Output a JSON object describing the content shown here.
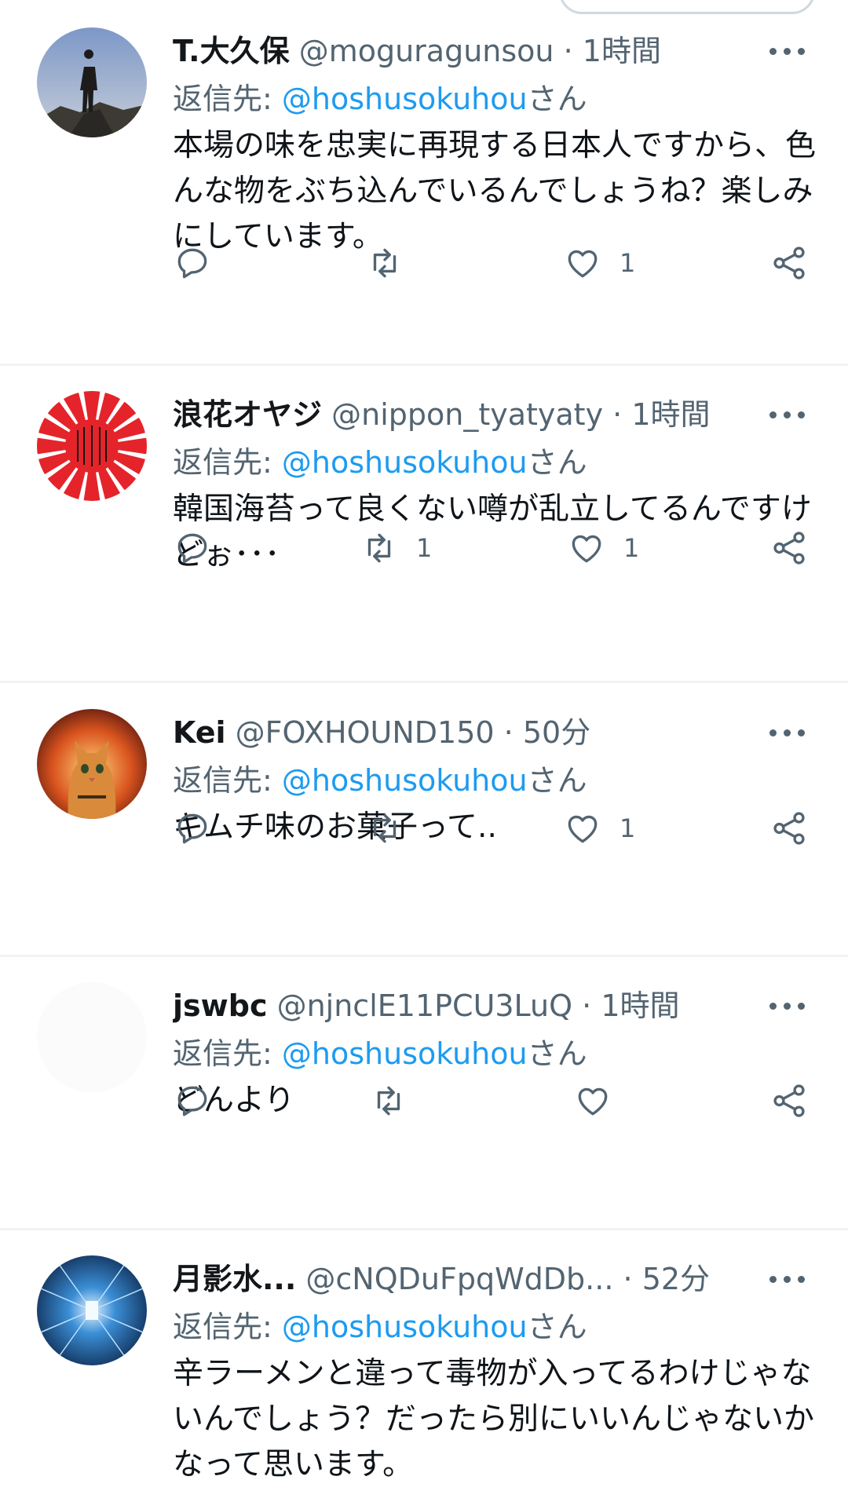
{
  "tweets": [
    {
      "name": "T.大久保",
      "handle": "@moguragunsou",
      "sep": "·",
      "time": "1時間",
      "reply_prefix": "返信先: ",
      "reply_mention": "@hoshusokuhou",
      "reply_suffix": "さん",
      "text": "本場の味を忠実に再現する日本人ですから、色んな物をぶち込んでいるんでしょうね？楽しみにしています。",
      "replies": "",
      "retweets": "",
      "likes": "1",
      "avatar": "mountain-silhouette"
    },
    {
      "name": "浪花オヤジ",
      "handle": "@nippon_tyatyaty",
      "sep": "·",
      "time": "1時間",
      "reply_prefix": "返信先: ",
      "reply_mention": "@hoshusokuhou",
      "reply_suffix": "さん",
      "text": "韓国海苔って良くない噂が乱立してるんですけどぉ･･･",
      "replies": "",
      "retweets": "1",
      "likes": "1",
      "avatar": "rising-sun-flag"
    },
    {
      "name": "Kei",
      "handle": "@FOXHOUND150",
      "sep": "·",
      "time": "50分",
      "reply_prefix": "返信先: ",
      "reply_mention": "@hoshusokuhou",
      "reply_suffix": "さん",
      "text": "キムチ味のお菓子って..",
      "replies": "",
      "retweets": "",
      "likes": "1",
      "avatar": "orange-cat"
    },
    {
      "name": "jswbc",
      "handle": "@njnclE11PCU3LuQ",
      "sep": "·",
      "time": "1時間",
      "reply_prefix": "返信先: ",
      "reply_mention": "@hoshusokuhou",
      "reply_suffix": "さん",
      "text": "どんより",
      "replies": "",
      "retweets": "",
      "likes": "",
      "avatar": "blank"
    },
    {
      "name": "月影水...",
      "handle": "@cNQDuFpqWdDb...",
      "sep": "·",
      "time": "52分",
      "reply_prefix": "返信先: ",
      "reply_mention": "@hoshusokuhou",
      "reply_suffix": "さん",
      "text": "辛ラーメンと違って毒物が入ってるわけじゃないんでしょう？だったら別にいいんじゃないかなって思います。",
      "replies": "",
      "retweets": "",
      "likes": "",
      "avatar": "blue-corridor"
    }
  ],
  "colors": {
    "accent": "#1d9bf0",
    "secondary_text": "#536471",
    "divider": "#eff3f4"
  }
}
